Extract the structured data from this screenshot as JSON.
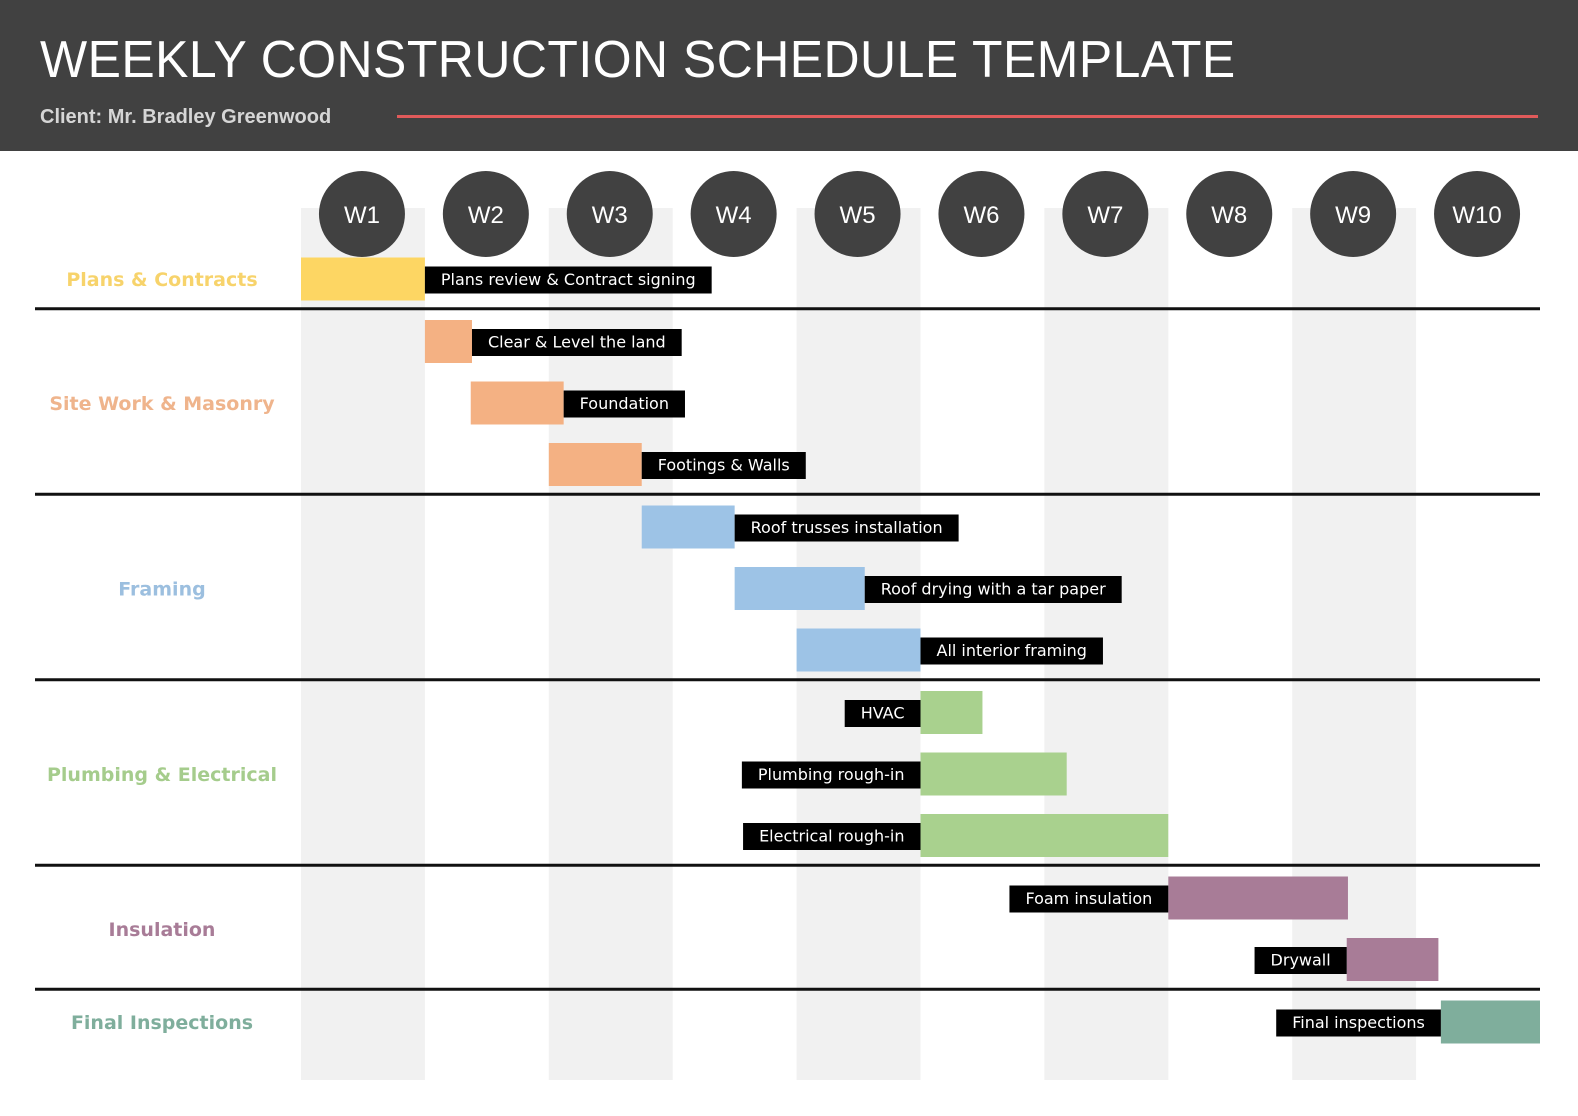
{
  "header": {
    "title": "WEEKLY CONSTRUCTION SCHEDULE TEMPLATE",
    "client": "Client: Mr. Bradley Greenwood",
    "accent_color": "#e05a5a",
    "background_color": "#414141"
  },
  "chart_data": {
    "type": "gantt",
    "title": "WEEKLY CONSTRUCTION SCHEDULE TEMPLATE",
    "subtitle": "Client: Mr. Bradley Greenwood",
    "x_unit": "weeks",
    "xlim": [
      0,
      10
    ],
    "weeks": [
      "W1",
      "W2",
      "W3",
      "W4",
      "W5",
      "W6",
      "W7",
      "W8",
      "W9",
      "W10"
    ],
    "grid": "alternating shaded week columns (W1, W3, W5, W7, W9)",
    "categories": [
      {
        "name": "Plans & Contracts",
        "color": "#fdd663",
        "label_color": "#f7d36b",
        "tasks": [
          {
            "name": "Plans review & Contract signing",
            "start": 0.0,
            "end": 1.0,
            "label_side": "right"
          }
        ]
      },
      {
        "name": "Site Work & Masonry",
        "color": "#f4b183",
        "label_color": "#efb48c",
        "tasks": [
          {
            "name": "Clear & Level the land",
            "start": 1.0,
            "end": 1.38,
            "label_side": "right"
          },
          {
            "name": "Foundation",
            "start": 1.37,
            "end": 2.12,
            "label_side": "right"
          },
          {
            "name": "Footings & Walls",
            "start": 2.0,
            "end": 2.75,
            "label_side": "right"
          }
        ]
      },
      {
        "name": "Framing",
        "color": "#9dc3e6",
        "label_color": "#9cbfdf",
        "tasks": [
          {
            "name": "Roof trusses installation",
            "start": 2.75,
            "end": 3.5,
            "label_side": "right"
          },
          {
            "name": "Roof drying with a tar paper",
            "start": 3.5,
            "end": 4.55,
            "label_side": "right"
          },
          {
            "name": "All interior framing",
            "start": 4.0,
            "end": 5.0,
            "label_side": "right"
          }
        ]
      },
      {
        "name": "Plumbing & Electrical",
        "color": "#a9d18e",
        "label_color": "#a5cc8c",
        "tasks": [
          {
            "name": "HVAC",
            "start": 5.0,
            "end": 5.5,
            "label_side": "left"
          },
          {
            "name": "Plumbing rough-in",
            "start": 5.0,
            "end": 6.18,
            "label_side": "left"
          },
          {
            "name": "Electrical rough-in",
            "start": 5.0,
            "end": 7.0,
            "label_side": "left"
          }
        ]
      },
      {
        "name": "Insulation",
        "color": "#a87c97",
        "label_color": "#a87c97",
        "tasks": [
          {
            "name": "Foam insulation",
            "start": 7.0,
            "end": 8.45,
            "label_side": "left"
          },
          {
            "name": "Drywall",
            "start": 8.44,
            "end": 9.18,
            "label_side": "left"
          }
        ]
      },
      {
        "name": "Final Inspections",
        "color": "#7fae9c",
        "label_color": "#7fae9c",
        "tasks": [
          {
            "name": "Final inspections",
            "start": 9.2,
            "end": 10.0,
            "label_side": "left"
          }
        ]
      }
    ]
  }
}
